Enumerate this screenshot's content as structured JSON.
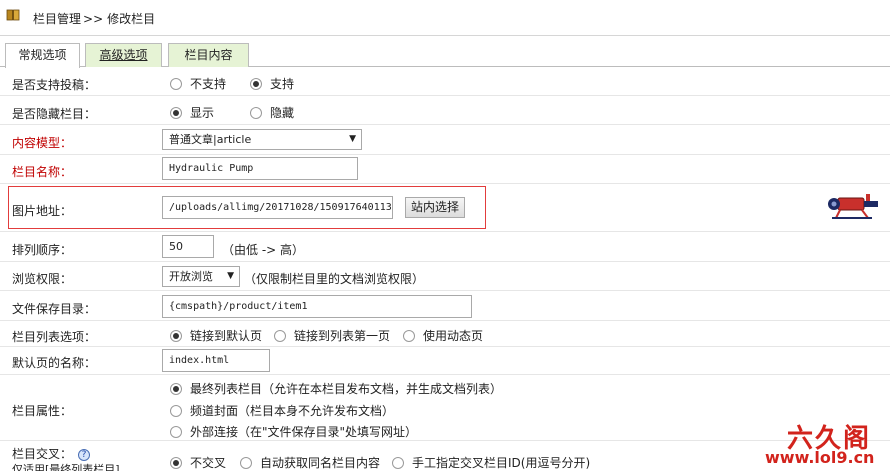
{
  "breadcrumb": {
    "section": "栏目管理",
    "separator": ">>",
    "page": "修改栏目"
  },
  "tabs": [
    {
      "label": "常规选项"
    },
    {
      "label": "高级选项"
    },
    {
      "label": "栏目内容"
    }
  ],
  "form": {
    "contribute": {
      "label": "是否支持投稿：",
      "options": [
        "不支持",
        "支持"
      ],
      "selected": 1
    },
    "hidden": {
      "label": "是否隐藏栏目：",
      "options": [
        "显示",
        "隐藏"
      ],
      "selected": 0
    },
    "model": {
      "label": "内容模型：",
      "value": "普通文章|article"
    },
    "typename": {
      "label": "栏目名称：",
      "value": "Hydraulic Pump"
    },
    "image": {
      "label": "图片地址：",
      "value": "/uploads/allimg/20171028/150917640113",
      "button": "站内选择"
    },
    "sortrank": {
      "label": "排列顺序：",
      "value": "50",
      "hint": "（由低 -> 高）"
    },
    "browse": {
      "label": "浏览权限：",
      "value": "开放浏览",
      "hint": "（仅限制栏目里的文档浏览权限）"
    },
    "savedir": {
      "label": "文件保存目录：",
      "value": "{cmspath}/product/item1"
    },
    "listopt": {
      "label": "栏目列表选项：",
      "options": [
        "链接到默认页",
        "链接到列表第一页",
        "使用动态页"
      ],
      "selected": 0
    },
    "defaultpage": {
      "label": "默认页的名称：",
      "value": "index.html"
    },
    "attr": {
      "label": "栏目属性：",
      "options": [
        "最终列表栏目（允许在本栏目发布文档，并生成文档列表）",
        "频道封面（栏目本身不允许发布文档）",
        "外部连接（在\"文件保存目录\"处填写网址）"
      ],
      "selected": 0
    },
    "cross": {
      "label": "栏目交叉：",
      "sublabel": "仅适用[最终列表栏目]",
      "options": [
        "不交叉",
        "自动获取同名栏目内容",
        "手工指定交叉栏目ID(用逗号分开)"
      ],
      "selected": 0
    }
  },
  "watermark": {
    "line1": "六久阁",
    "line2": "www.lol9.cn"
  },
  "colors": {
    "required_label": "#c00000",
    "tab_bg": "#e6f3d5",
    "highlight_border": "#e23c3c",
    "watermark": "#d2231c"
  }
}
